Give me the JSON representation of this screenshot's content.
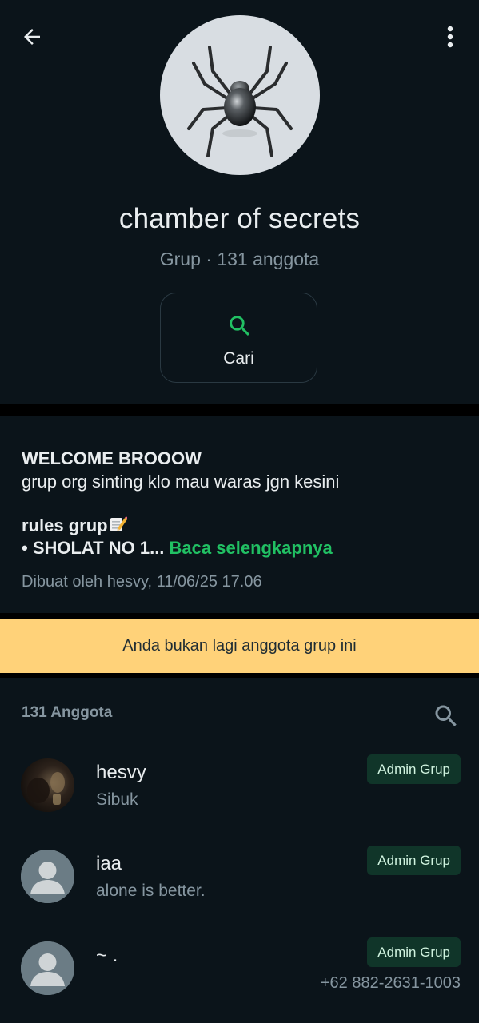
{
  "header": {
    "back_icon": "arrow-left-icon",
    "menu_icon": "more-vertical-icon",
    "avatar_icon": "spider-icon",
    "title": "chamber of secrets",
    "subtitle": "Grup · 131 anggota",
    "search_action": {
      "label": "Cari",
      "icon": "search-icon",
      "color": "#21c063"
    }
  },
  "description": {
    "line1": "WELCOME BROOOW",
    "line2": "grup org sinting klo mau waras jgn kesini",
    "line3": "rules grup",
    "line3_icon": "memo-pencil-icon",
    "line4": "• SHOLAT NO 1...",
    "read_more": "Baca selengkapnya",
    "created_by": "Dibuat oleh hesvy, 11/06/25 17.06"
  },
  "banner": {
    "text": "Anda bukan lagi anggota grup ini",
    "color": "#ffd279"
  },
  "members": {
    "count_label": "131 Anggota",
    "search_icon": "search-icon",
    "list": [
      {
        "name": "hesvy",
        "status": "Sibuk",
        "badge": "Admin Grup",
        "avatar": "photo-avatar"
      },
      {
        "name": "iaa",
        "status": "alone is better.",
        "badge": "Admin Grup",
        "avatar": "default-person-icon"
      },
      {
        "name": "~ .",
        "phone": "+62 882-2631-1003",
        "badge": "Admin Grup",
        "avatar": "default-person-icon"
      }
    ]
  },
  "colors": {
    "background": "#0b141a",
    "accent": "#21c063",
    "secondary_text": "#8696a0",
    "badge_bg": "#103529"
  }
}
